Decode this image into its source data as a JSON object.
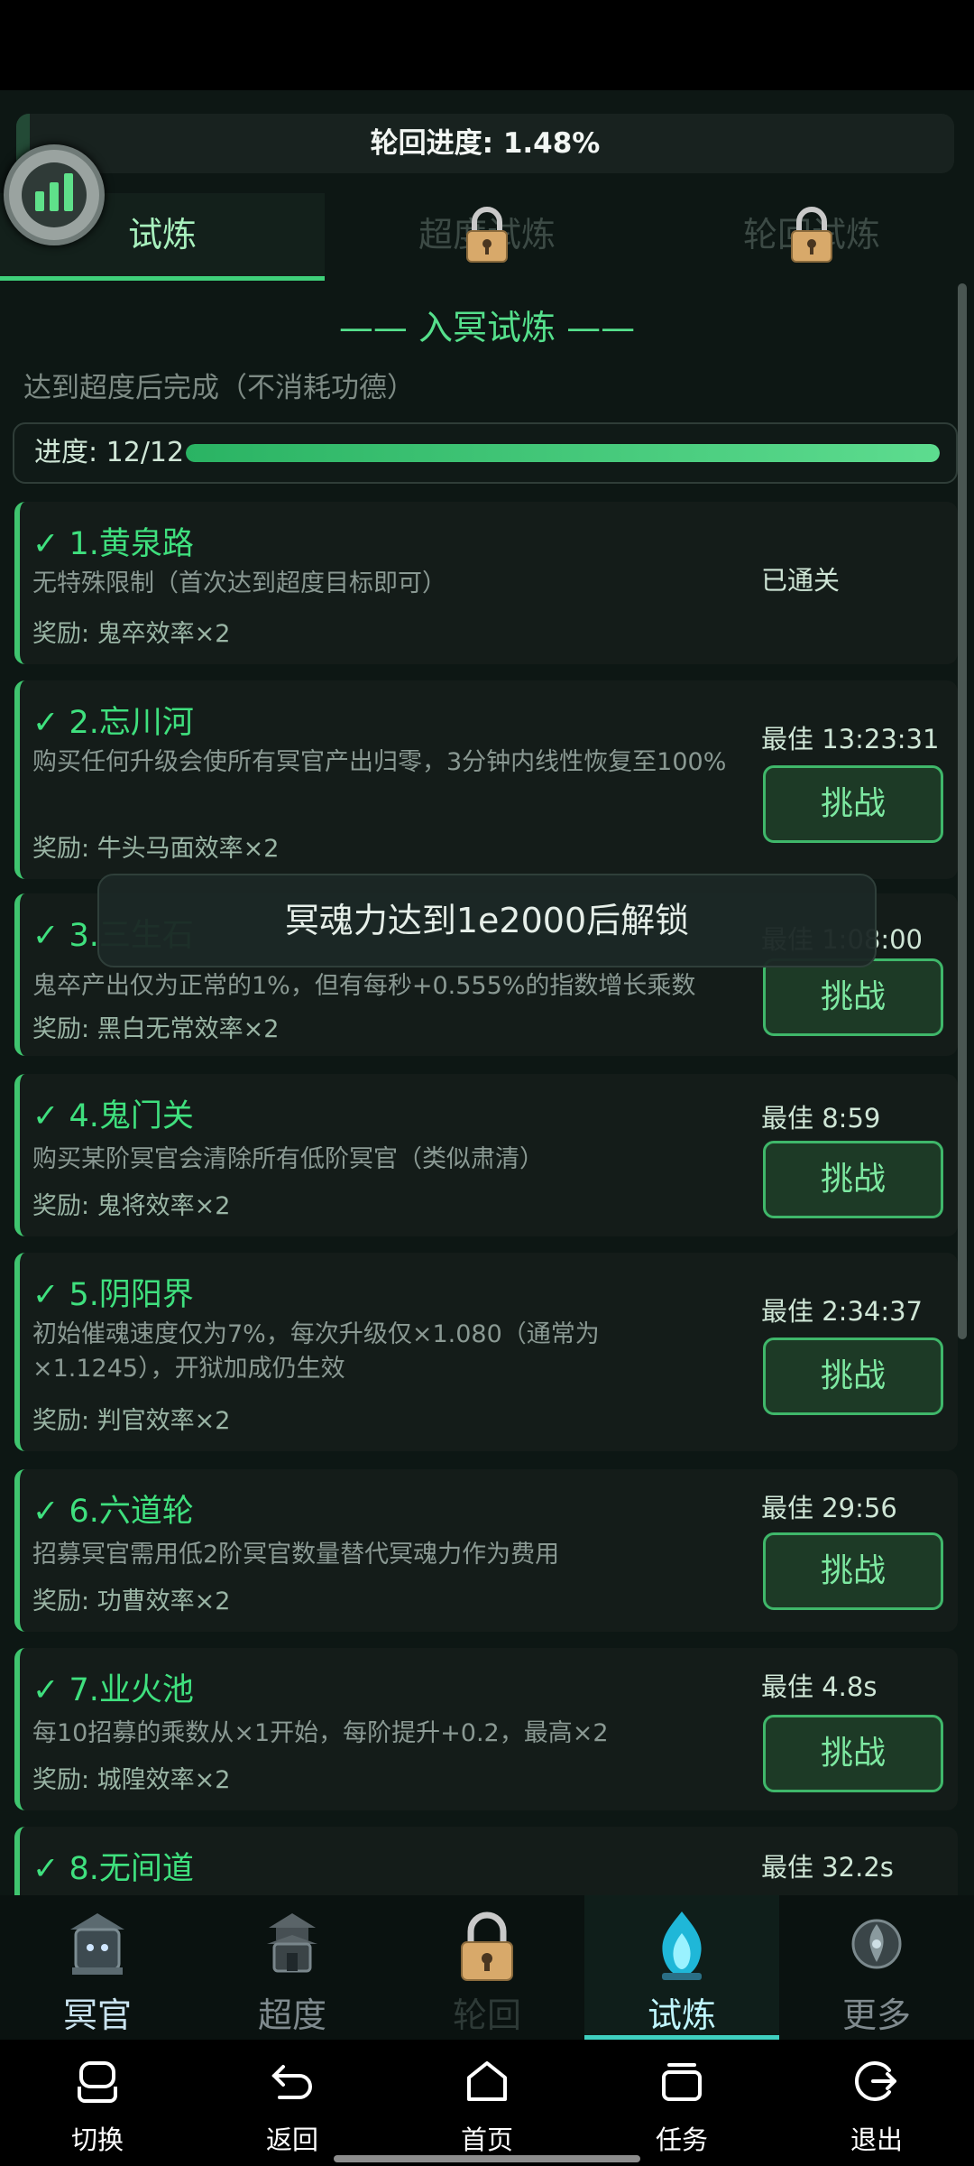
{
  "header": {
    "progress_label": "轮回进度: 1.48%",
    "progress_value": 0.0148
  },
  "subtabs": [
    {
      "label": "试炼",
      "locked": false,
      "active": true
    },
    {
      "label": "超度试炼",
      "locked": true,
      "active": false
    },
    {
      "label": "轮回试炼",
      "locked": true,
      "active": false
    }
  ],
  "section": {
    "title": "—— 入冥试炼 ——",
    "subtitle": "达到超度后完成（不消耗功德）"
  },
  "trial_progress": {
    "label": "进度: 12/12",
    "value": 1.0
  },
  "trials": [
    {
      "name": "✓ 1.黄泉路",
      "desc": "无特殊限制（首次达到超度目标即可）",
      "reward": "奖励: 鬼卒效率×2",
      "status": "已通关"
    },
    {
      "name": "✓ 2.忘川河",
      "desc": "购买任何升级会使所有冥官产出归零，3分钟内线性恢复至100%",
      "reward": "奖励: 牛头马面效率×2",
      "best": "最佳 13:23:31",
      "button": "挑战"
    },
    {
      "name": "✓ 3.三生石",
      "desc": "鬼卒产出仅为正常的1%，但有每秒+0.555%的指数增长乘数",
      "reward": "奖励: 黑白无常效率×2",
      "best": "最佳 1:08:00",
      "button": "挑战"
    },
    {
      "name": "✓ 4.鬼门关",
      "desc": "购买某阶冥官会清除所有低阶冥官（类似肃清）",
      "reward": "奖励: 鬼将效率×2",
      "best": "最佳 8:59",
      "button": "挑战"
    },
    {
      "name": "✓ 5.阴阳界",
      "desc": "初始催魂速度仅为7%，每次升级仅×1.080（通常为×1.1245），开狱加成仍生效",
      "reward": "奖励: 判官效率×2",
      "best": "最佳 2:34:37",
      "button": "挑战"
    },
    {
      "name": "✓ 6.六道轮",
      "desc": "招募冥官需用低2阶冥官数量替代冥魂力作为费用",
      "reward": "奖励: 功曹效率×2",
      "best": "最佳 29:56",
      "button": "挑战"
    },
    {
      "name": "✓ 7.业火池",
      "desc": "每10招募的乘数从×1开始，每阶提升+0.2，最高×2",
      "reward": "奖励: 城隍效率×2",
      "best": "最佳 4.8s",
      "button": "挑战"
    },
    {
      "name": "✓ 8.无间道",
      "best": "最佳 32.2s"
    }
  ],
  "toast": "冥魂力达到1e2000后解锁",
  "bottom_nav": [
    {
      "label": "冥官",
      "icon": "gate-icon",
      "active": false,
      "locked": false
    },
    {
      "label": "超度",
      "icon": "pagoda-icon",
      "active": false,
      "locked": false
    },
    {
      "label": "轮回",
      "icon": "lock-icon",
      "active": false,
      "locked": true
    },
    {
      "label": "试炼",
      "icon": "blue-flame-icon",
      "active": true,
      "locked": false
    },
    {
      "label": "更多",
      "icon": "ornament-icon",
      "active": false,
      "locked": false
    }
  ],
  "system_nav": [
    {
      "label": "切换",
      "icon": "switch-icon"
    },
    {
      "label": "返回",
      "icon": "back-icon"
    },
    {
      "label": "首页",
      "icon": "home-icon"
    },
    {
      "label": "任务",
      "icon": "tasks-icon"
    },
    {
      "label": "退出",
      "icon": "exit-icon"
    }
  ],
  "colors": {
    "accent_green": "#3fe07e",
    "active_cyan": "#3fd0c0",
    "background": "#0d1714"
  }
}
